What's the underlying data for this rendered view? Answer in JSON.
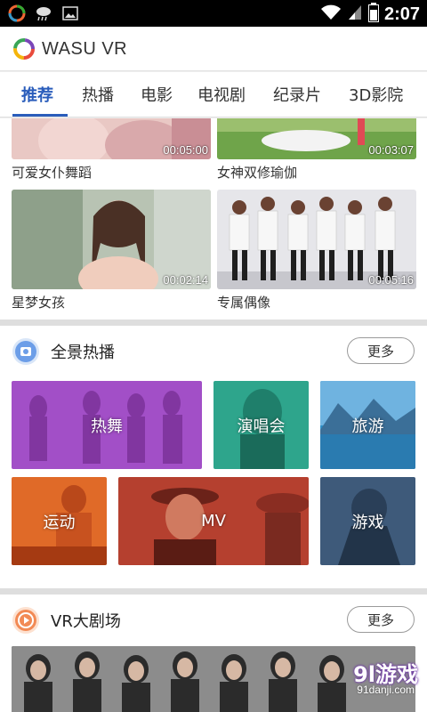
{
  "status_bar": {
    "time": "2:07",
    "icons": [
      "app-icon",
      "weather-cloud-icon",
      "image-icon",
      "wifi-icon",
      "signal-icon",
      "battery-icon"
    ]
  },
  "app": {
    "brand": "WASU VR"
  },
  "tabs": [
    {
      "label": "推荐",
      "active": true
    },
    {
      "label": "热播",
      "active": false
    },
    {
      "label": "电影",
      "active": false
    },
    {
      "label": "电视剧",
      "active": false
    },
    {
      "label": "纪录片",
      "active": false
    },
    {
      "label": "3D影院",
      "active": false
    }
  ],
  "videos": [
    {
      "title": "可爱女仆舞蹈",
      "duration": "00:05:00"
    },
    {
      "title": "女神双修瑜伽",
      "duration": "00:03:07"
    },
    {
      "title": "星梦女孩",
      "duration": "00:02:14"
    },
    {
      "title": "专属偶像",
      "duration": "00:05:16"
    }
  ],
  "panorama": {
    "title": "全景热播",
    "more": "更多",
    "tiles": [
      "热舞",
      "演唱会",
      "旅游",
      "运动",
      "MV",
      "游戏"
    ]
  },
  "theater": {
    "title": "VR大剧场",
    "more": "更多"
  },
  "watermark": {
    "text": "9l游戏",
    "sub": "91danji.com"
  },
  "colors": {
    "accent": "#2a5dbb",
    "tile_dance": "#a24fc7",
    "tile_concert": "#2ea58c",
    "tile_travel": "#2d8fc7",
    "tile_sport": "#e06a28",
    "tile_mv": "#b5402f",
    "tile_game": "#3e5a7a"
  }
}
